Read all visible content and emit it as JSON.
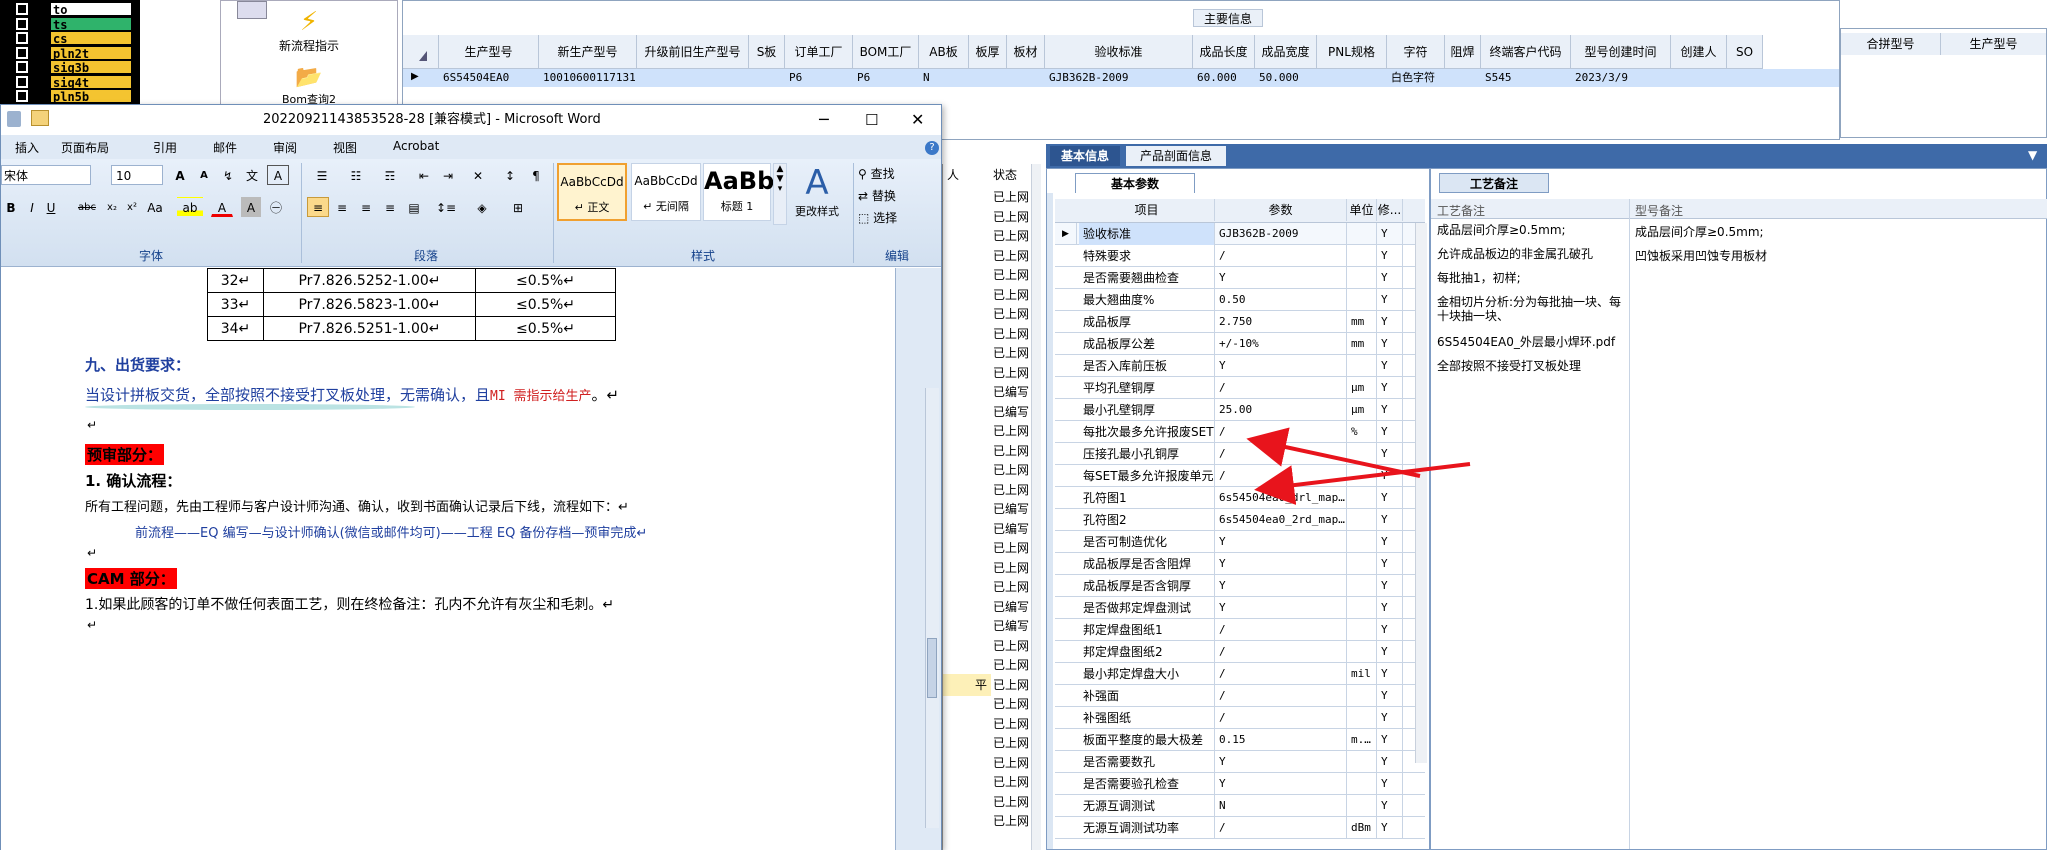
{
  "layers": [
    {
      "name": "to",
      "color": "#ffffff"
    },
    {
      "name": "ts",
      "color": "#2fb36b"
    },
    {
      "name": "cs",
      "color": "#f4c430"
    },
    {
      "name": "pln2t",
      "color": "#f4c430"
    },
    {
      "name": "sig3b",
      "color": "#f4c430"
    },
    {
      "name": "sig4t",
      "color": "#f4c430"
    },
    {
      "name": "pln5b",
      "color": "#f4c430"
    }
  ],
  "toolbar": {
    "new_flow": "新流程指示",
    "bom": "Bom查询2"
  },
  "main_grid": {
    "caption": "主要信息",
    "columns": [
      "生产型号",
      "新生产型号",
      "升级前旧生产型号",
      "S板",
      "订单工厂",
      "BOM工厂",
      "AB板",
      "板厚",
      "板材",
      "验收标准",
      "成品长度",
      "成品宽度",
      "PNL规格",
      "字符",
      "阻焊",
      "终端客户代码",
      "型号创建时间",
      "创建人",
      "SO"
    ],
    "row": [
      "6S54504EA0",
      "10010600117131",
      "",
      "",
      "P6",
      "P6",
      "N",
      "",
      "",
      "GJB362B-2009",
      "60.000",
      "50.000",
      "",
      "白色字符",
      "",
      "S545",
      "2023/3/9",
      "",
      ""
    ]
  },
  "right_grid": {
    "columns": [
      "合拼型号",
      "生产型号"
    ]
  },
  "word": {
    "title": "20220921143853528-28 [兼容模式] - Microsoft Word",
    "tabs": [
      "插入",
      "页面布局",
      "引用",
      "邮件",
      "审阅",
      "视图",
      "Acrobat"
    ],
    "font_name": "宋体",
    "font_size": "10",
    "groups": {
      "font": "字体",
      "paragraph": "段落",
      "styles": "样式",
      "edit": "编辑"
    },
    "styles": [
      {
        "preview": "AaBbCcDd",
        "name": "↵ 正文"
      },
      {
        "preview": "AaBbCcDd",
        "name": "↵ 无间隔"
      },
      {
        "preview": "AaBb",
        "name": "标题 1"
      }
    ],
    "change_style": "更改样式",
    "find": "查找",
    "replace": "替换",
    "select": "选择",
    "table_rows": [
      [
        "32↵",
        "Pr7.826.5252-1.00↵",
        "≤0.5%↵"
      ],
      [
        "33↵",
        "Pr7.826.5823-1.00↵",
        "≤0.5%↵"
      ],
      [
        "34↵",
        "Pr7.826.5251-1.00↵",
        "≤0.5%↵"
      ]
    ],
    "heading_ship": "九、出货要求：",
    "ship_text_a": "当设计拼板交货，全部按照不接受打叉板处理，无需确认，且",
    "ship_text_b": "MI 需指示给生产",
    "ship_text_c": "。↵",
    "pre_audit": "预审部分：",
    "confirm_title": "1. 确认流程：",
    "confirm_text": "所有工程问题，先由工程师与客户设计师沟通、确认，收到书面确认记录后下线，流程如下：↵",
    "flow_text": "前流程——EQ 编写—与设计师确认(微信或邮件均可)——工程 EQ 备份存档—预审完成↵",
    "cam": "CAM 部分：",
    "cam_text": "1.如果此顾客的订单不做任何表面工艺，则在终检备注：孔内不允许有灰尘和毛刺。↵",
    "para_mark": "↵"
  },
  "mid_list": {
    "headers": [
      "人",
      "状态"
    ],
    "items": [
      "已上网",
      "已上网",
      "已上网",
      "已上网",
      "已上网",
      "已上网",
      "已上网",
      "已上网",
      "已上网",
      "已上网",
      "已编写",
      "已编写",
      "已上网",
      "已上网",
      "已上网",
      "已上网",
      "已编写",
      "已编写",
      "已上网",
      "已上网",
      "已上网",
      "已编写",
      "已编写",
      "已上网",
      "已上网",
      "已上网",
      "已上网",
      "已上网",
      "已上网",
      "已上网",
      "已上网",
      "已上网",
      "已上网"
    ],
    "highlight_label": "平"
  },
  "detail": {
    "tab_basic": "基本信息",
    "tab_profile": "产品剖面信息",
    "sub_basic": "基本参数",
    "sub_craft": "工艺备注",
    "cols": [
      "项目",
      "参数",
      "单位",
      "修..."
    ],
    "rows": [
      [
        "验收标准",
        "GJB362B-2009",
        "",
        "Y"
      ],
      [
        "特殊要求",
        "/",
        "",
        "Y"
      ],
      [
        "是否需要翘曲检查",
        "Y",
        "",
        "Y"
      ],
      [
        "最大翘曲度%",
        "0.50",
        "",
        "Y"
      ],
      [
        "成品板厚",
        "2.750",
        "mm",
        "Y"
      ],
      [
        "成品板厚公差",
        "+/-10%",
        "mm",
        "Y"
      ],
      [
        "是否入库前压板",
        "Y",
        "",
        "Y"
      ],
      [
        "平均孔壁铜厚",
        "/",
        "μm",
        "Y"
      ],
      [
        "最小孔壁铜厚",
        "25.00",
        "μm",
        "Y"
      ],
      [
        "每批次最多允许报废SET",
        "/",
        "%",
        "Y"
      ],
      [
        "压接孔最小孔铜厚",
        "/",
        "",
        "Y"
      ],
      [
        "每SET最多允许报废单元",
        "/",
        "",
        "Y"
      ],
      [
        "孔符图1",
        "6s54504ea0_drl_map...",
        "",
        "Y"
      ],
      [
        "孔符图2",
        "6s54504ea0_2rd_map...",
        "",
        "Y"
      ],
      [
        "是否可制造优化",
        "Y",
        "",
        "Y"
      ],
      [
        "成品板厚是否含阻焊",
        "Y",
        "",
        "Y"
      ],
      [
        "成品板厚是否含铜厚",
        "Y",
        "",
        "Y"
      ],
      [
        "是否做邦定焊盘测试",
        "Y",
        "",
        "Y"
      ],
      [
        "邦定焊盘图纸1",
        "/",
        "",
        "Y"
      ],
      [
        "邦定焊盘图纸2",
        "/",
        "",
        "Y"
      ],
      [
        "最小邦定焊盘大小",
        "/",
        "mil",
        "Y"
      ],
      [
        "补强面",
        "/",
        "",
        "Y"
      ],
      [
        "补强图纸",
        "/",
        "",
        "Y"
      ],
      [
        "板面平整度的最大极差",
        "0.15",
        "m...",
        "Y"
      ],
      [
        "是否需要数孔",
        "Y",
        "",
        "Y"
      ],
      [
        "是否需要验孔检查",
        "Y",
        "",
        "Y"
      ],
      [
        "无源互调测试",
        "N",
        "",
        "Y"
      ],
      [
        "无源互调测试功率",
        "/",
        "dBm",
        "Y"
      ]
    ],
    "craft_cols": [
      "工艺备注",
      "型号备注"
    ],
    "craft_notes": [
      "成品层间介厚≥0.5mm;",
      "允许成品板边的非金属孔破孔",
      "每批抽1，初样;",
      "金相切片分析:分为每批抽一块、每十块抽一块、",
      "6S54504EA0_外层最小焊环.pdf",
      "全部按照不接受打叉板处理"
    ],
    "model_notes": [
      "成品层间介厚≥0.5mm;",
      "凹蚀板采用凹蚀专用板材"
    ]
  },
  "colors": {
    "arrow": "#e8141c",
    "accent": "#3e6aa8",
    "selected_row": "#cfe2fb"
  }
}
